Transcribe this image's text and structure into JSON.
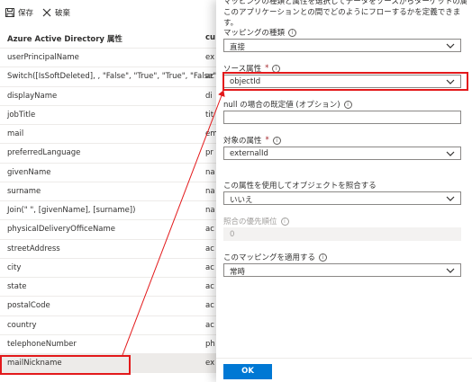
{
  "toolbar": {
    "save_label": "保存",
    "discard_label": "破棄"
  },
  "table": {
    "header_a": "Azure Active Directory 属性",
    "header_b": "cu",
    "rows": [
      {
        "a": "userPrincipalName",
        "b": "ex"
      },
      {
        "a": "Switch([IsSoftDeleted], , \"False\", \"True\", \"True\", \"False\")",
        "b": "ac"
      },
      {
        "a": "displayName",
        "b": "di"
      },
      {
        "a": "jobTitle",
        "b": "tit"
      },
      {
        "a": "mail",
        "b": "em"
      },
      {
        "a": "preferredLanguage",
        "b": "pr"
      },
      {
        "a": "givenName",
        "b": "na"
      },
      {
        "a": "surname",
        "b": "na"
      },
      {
        "a": "Join(\" \", [givenName], [surname])",
        "b": "na"
      },
      {
        "a": "physicalDeliveryOfficeName",
        "b": "ac"
      },
      {
        "a": "streetAddress",
        "b": "ac"
      },
      {
        "a": "city",
        "b": "ac"
      },
      {
        "a": "state",
        "b": "ac"
      },
      {
        "a": "postalCode",
        "b": "ac"
      },
      {
        "a": "country",
        "b": "ac"
      },
      {
        "a": "telephoneNumber",
        "b": "ph"
      },
      {
        "a": "mailNickname",
        "b": "ex"
      }
    ]
  },
  "panel": {
    "desc_line1": "マッピングの種類と属性を選択してデータをソースからターゲットの属性に",
    "desc_line2": "このアプリケーションとの間でどのようにフローするかを定義できます。",
    "mapping_type_label": "マッピングの種類",
    "mapping_type_value": "直接",
    "source_label": "ソース属性",
    "source_value": "objectId",
    "default_label": "null の場合の既定値 (オプション)",
    "default_value": "",
    "target_label": "対象の属性",
    "target_value": "externalId",
    "match_label": "この属性を使用してオブジェクトを照合する",
    "match_value": "いいえ",
    "priority_label": "照合の優先順位",
    "priority_value": "0",
    "apply_label": "このマッピングを適用する",
    "apply_value": "常時",
    "required_mark": "*",
    "info_glyph": "i",
    "ok_label": "OK"
  },
  "colors": {
    "highlight": "#e3191b",
    "primary": "#0078d4"
  },
  "icons": [
    "save-icon",
    "discard-icon",
    "info-icon",
    "chevron-down-icon"
  ]
}
